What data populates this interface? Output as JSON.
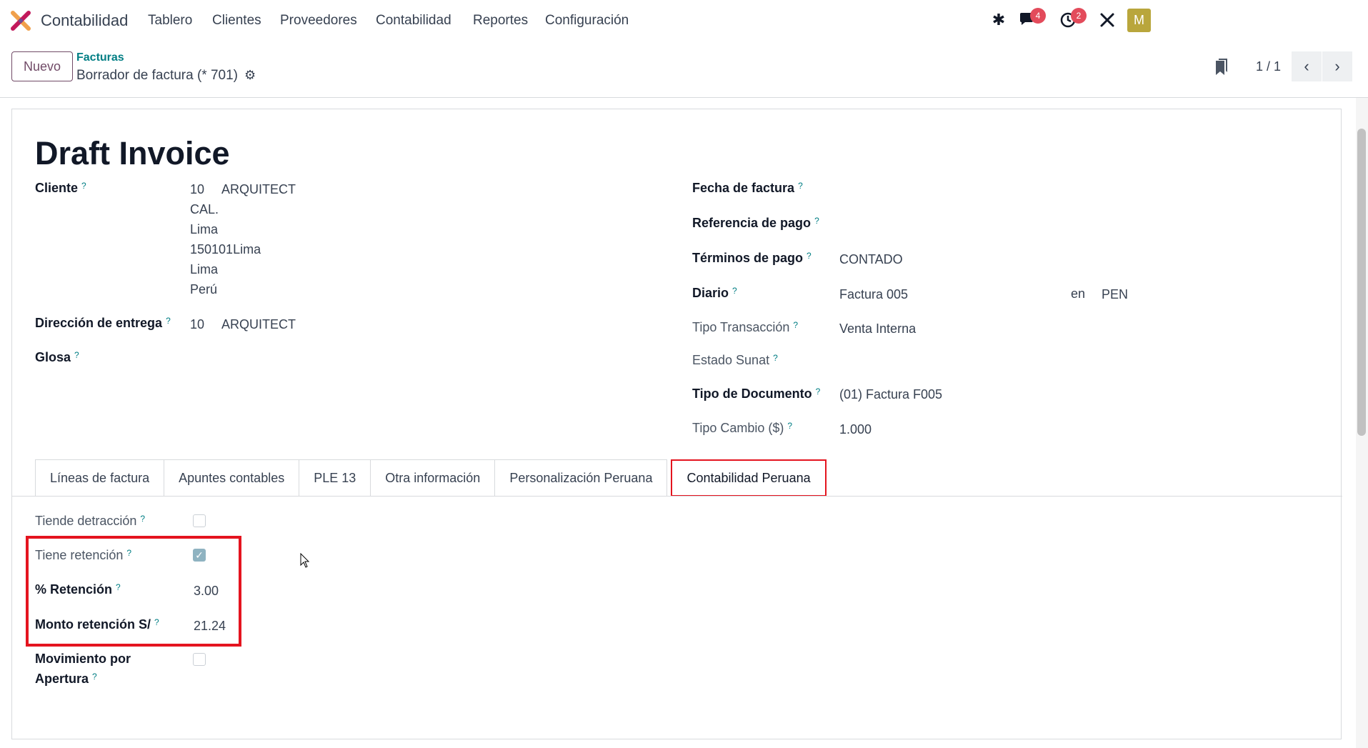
{
  "navbar": {
    "app_name": "Contabilidad",
    "menu": [
      "Tablero",
      "Clientes",
      "Proveedores",
      "Contabilidad",
      "Reportes",
      "Configuración"
    ],
    "messages_badge": "4",
    "activities_badge": "2",
    "avatar_letter": "M"
  },
  "control_panel": {
    "new_button": "Nuevo",
    "breadcrumb_parent": "Facturas",
    "breadcrumb_current": "Borrador de factura (* 701)",
    "pager": "1 / 1"
  },
  "form": {
    "title": "Draft Invoice",
    "left": {
      "cliente_label": "Cliente",
      "cliente_lines": [
        "10",
        "ARQUITECT",
        "CAL.",
        "Lima",
        "150101Lima",
        "Lima",
        "Perú"
      ],
      "entrega_label": "Dirección de entrega",
      "entrega_code": "10",
      "entrega_name": "ARQUITECT",
      "glosa_label": "Glosa"
    },
    "right": {
      "fecha_label": "Fecha de factura",
      "referencia_label": "Referencia de pago",
      "terminos_label": "Términos de pago",
      "terminos_value": "CONTADO",
      "diario_label": "Diario",
      "diario_value": "Factura 005",
      "diario_en": "en",
      "diario_currency": "PEN",
      "tipo_trans_label": "Tipo Transacción",
      "tipo_trans_value": "Venta Interna",
      "estado_label": "Estado Sunat",
      "tipo_doc_label": "Tipo de Documento",
      "tipo_doc_value": "(01) Factura F005",
      "tipo_cambio_label": "Tipo Cambio ($)",
      "tipo_cambio_value": "1.000"
    },
    "help_mark": "?",
    "tabs": [
      "Líneas de factura",
      "Apuntes contables",
      "PLE 13",
      "Otra información",
      "Personalización Peruana",
      "Contabilidad Peruana"
    ],
    "active_tab": "Contabilidad Peruana",
    "peru_tab": {
      "detraccion_label": "Tiende detracción",
      "detraccion_checked": false,
      "retencion_label": "Tiene retención",
      "retencion_checked": true,
      "pct_label": "% Retención",
      "pct_value": "3.00",
      "monto_label": "Monto retención S/",
      "monto_value": "21.24",
      "apertura_label_1": "Movimiento por",
      "apertura_label_2": "Apertura",
      "apertura_checked": false
    }
  },
  "colors": {
    "primary": "#714b67",
    "link": "#017e84",
    "highlight": "#e4141f",
    "badge": "#e34b5b"
  }
}
